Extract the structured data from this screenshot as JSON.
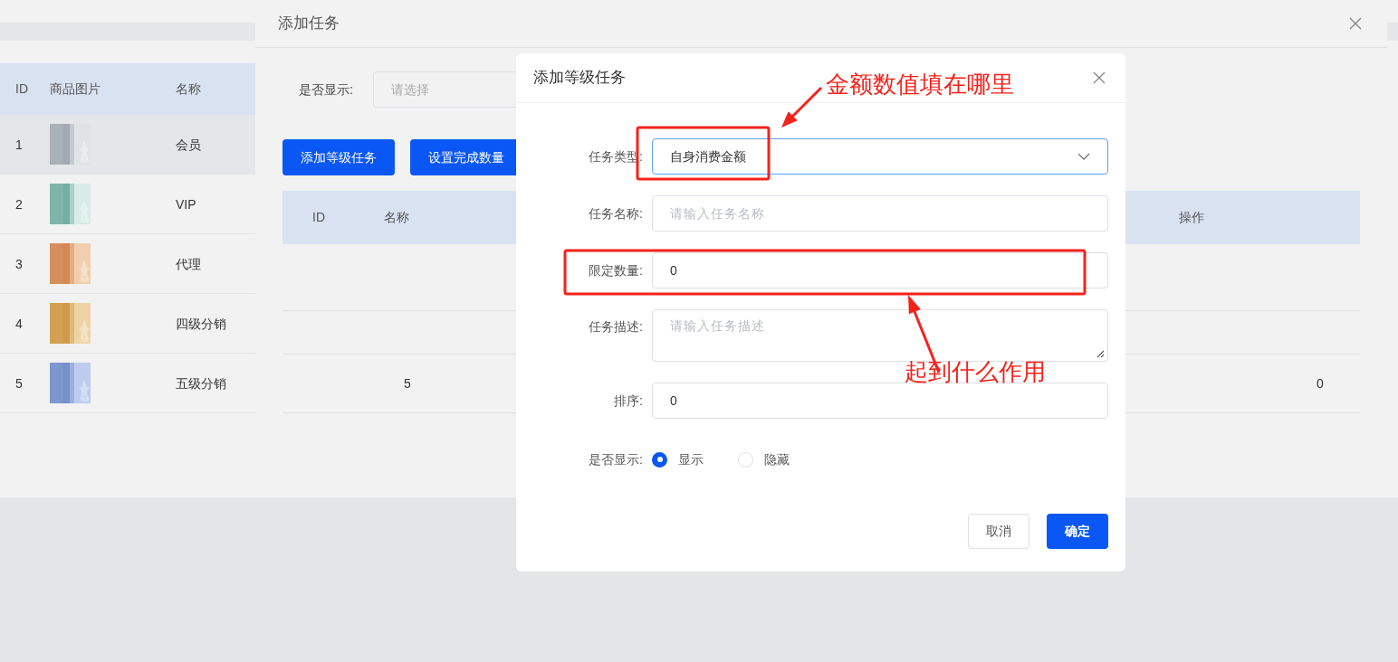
{
  "page_table": {
    "columns": [
      "ID",
      "商品图片",
      "名称"
    ],
    "rows": [
      {
        "id": "1",
        "name": "会员",
        "highlighted": true
      },
      {
        "id": "2",
        "name": "VIP",
        "highlighted": false
      },
      {
        "id": "3",
        "name": "代理",
        "highlighted": false
      },
      {
        "id": "4",
        "name": "四级分销",
        "highlighted": false
      },
      {
        "id": "5",
        "name": "五级分销",
        "highlighted": false
      }
    ]
  },
  "task_panel": {
    "title": "添加任务",
    "filter": {
      "label": "是否显示:",
      "placeholder": "请选择"
    },
    "buttons": [
      "添加等级任务",
      "设置完成数量"
    ],
    "table": {
      "columns": [
        "ID",
        "名称",
        "操作"
      ],
      "rows": [
        {
          "cells": [
            "",
            "5",
            "0"
          ]
        }
      ]
    }
  },
  "dialog": {
    "title": "添加等级任务",
    "fields": [
      {
        "kind": "select",
        "label": "任务类型:",
        "value": "自身消费金额",
        "focused": true
      },
      {
        "kind": "input",
        "label": "任务名称:",
        "placeholder": "请输入任务名称",
        "focused": false
      },
      {
        "kind": "input",
        "label": "限定数量:",
        "value": "0",
        "focused": false
      },
      {
        "kind": "textarea",
        "label": "任务描述:",
        "placeholder": "请输入任务描述",
        "focused": false
      },
      {
        "kind": "input",
        "label": "排序:",
        "value": "0",
        "focused": false
      },
      {
        "kind": "radio",
        "label": "是否显示:",
        "options": [
          {
            "label": "显示",
            "selected": true
          },
          {
            "label": "隐藏",
            "selected": false
          }
        ]
      }
    ],
    "buttons": [
      {
        "label": "取消",
        "kind": "default"
      },
      {
        "label": "确定",
        "kind": "primary"
      }
    ]
  },
  "annotations": [
    {
      "text": "金额数值填在哪里"
    },
    {
      "text": "起到什么作用"
    }
  ]
}
